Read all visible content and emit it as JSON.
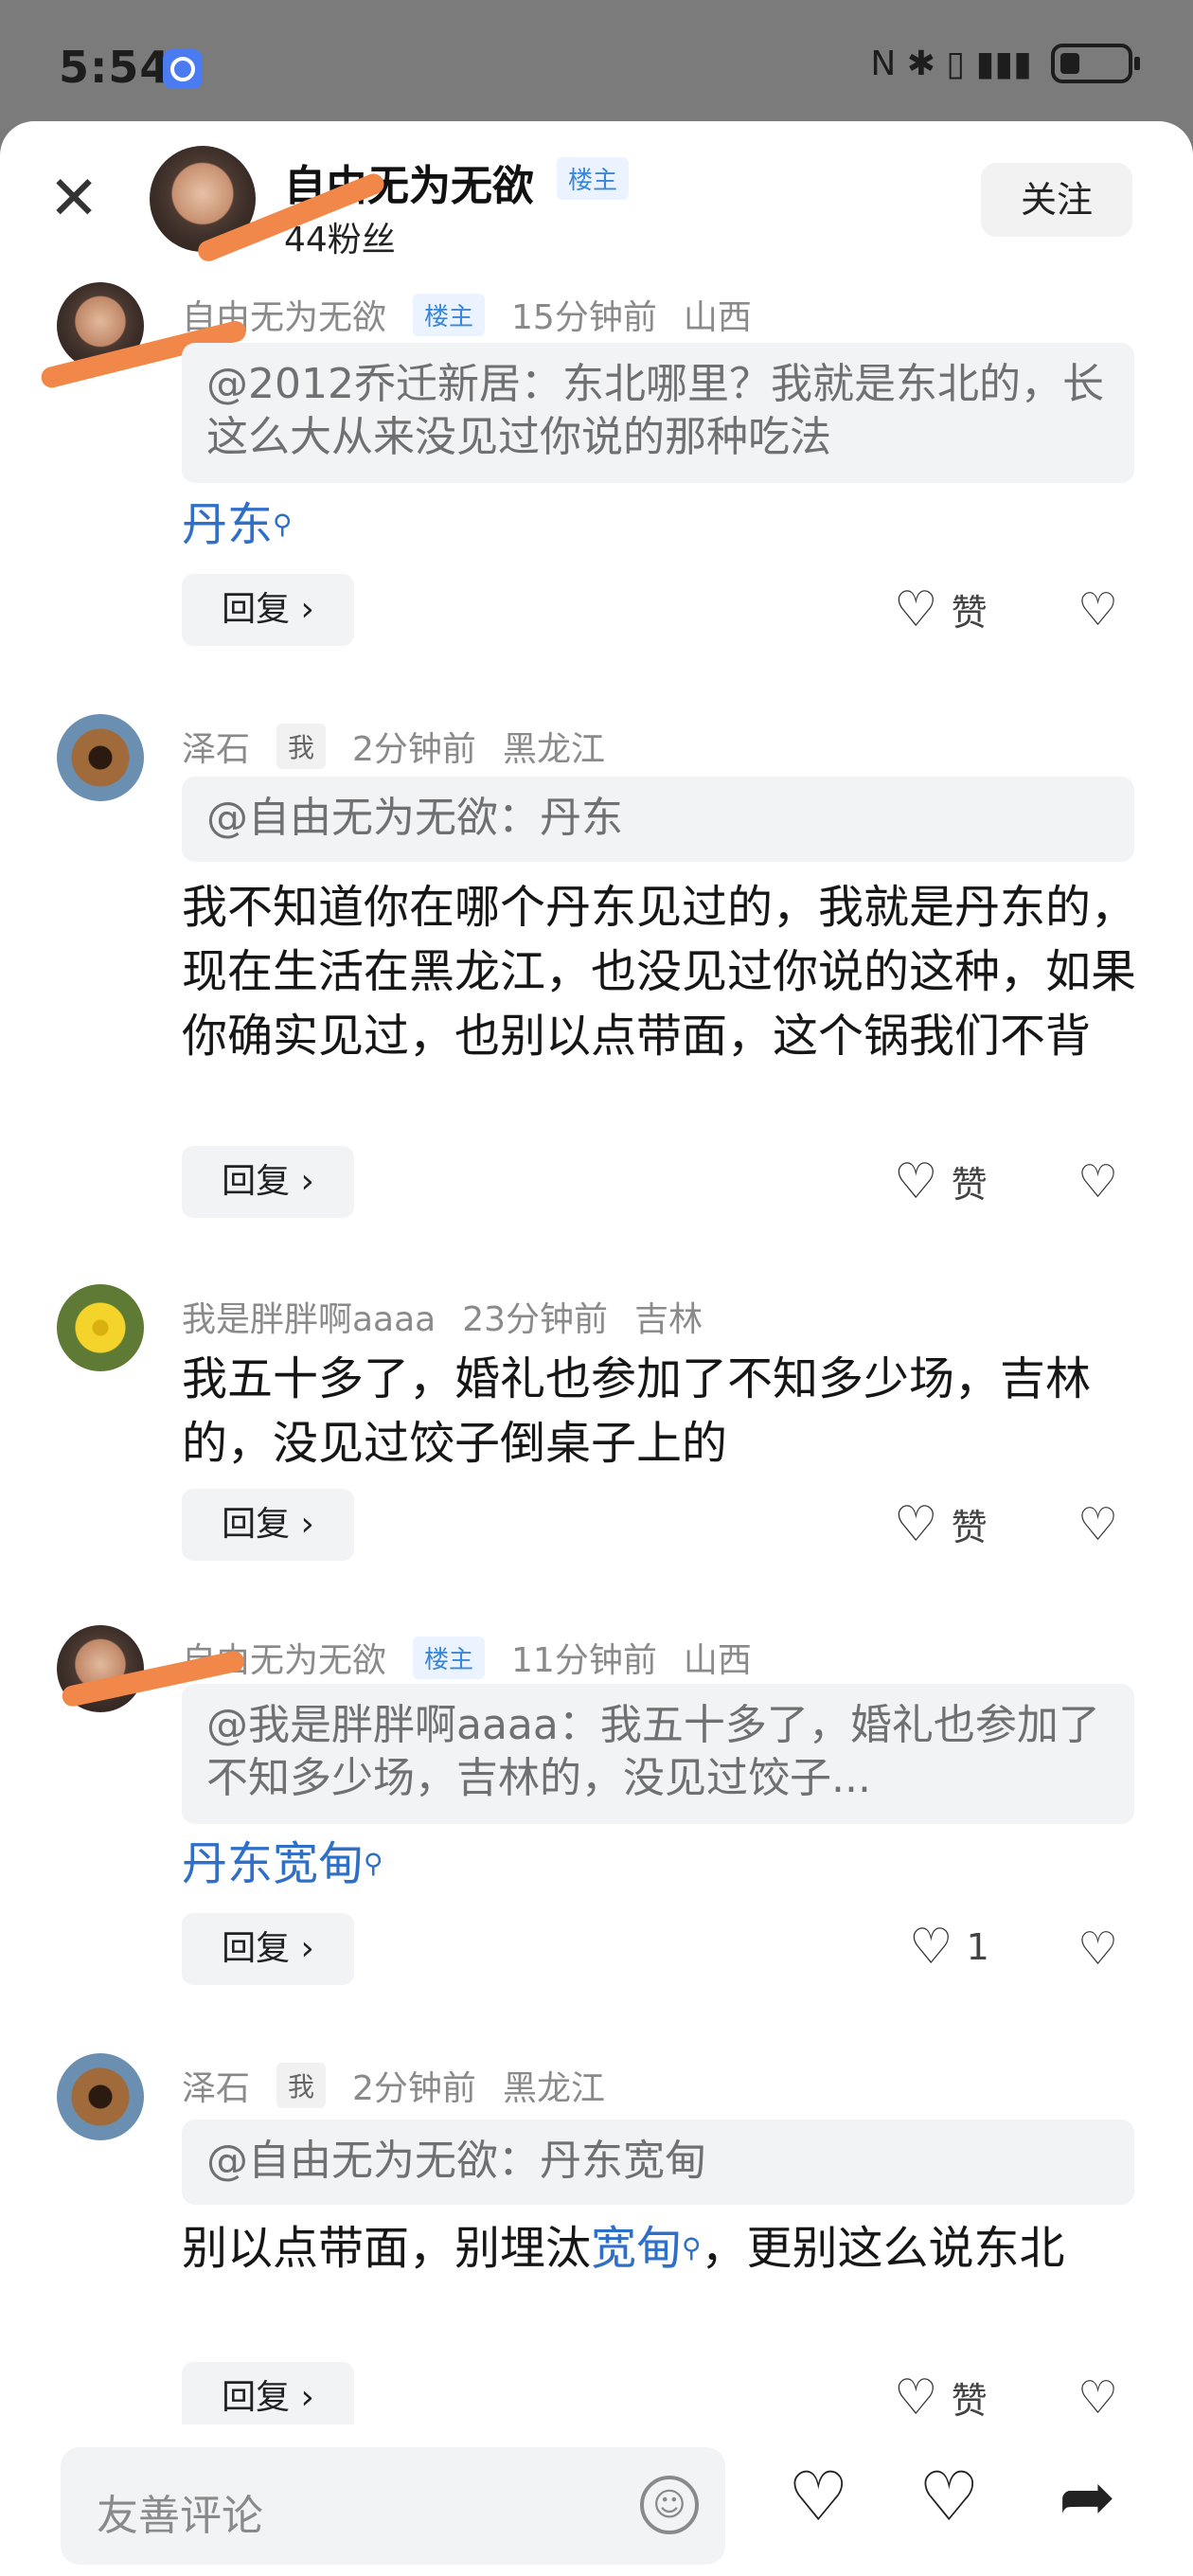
{
  "status": {
    "time": "5:54",
    "icons": "N ✱ ▯ ▮▮▮"
  },
  "header": {
    "name": "自由无为无欲",
    "badge": "楼主",
    "fans": "44粉丝",
    "follow": "关注",
    "close": "✕"
  },
  "comments": [
    {
      "user": "自由无为无欲",
      "badge": "楼主",
      "time": "15分钟前",
      "location": "山西",
      "quote": "@2012乔迁新居：东北哪里？我就是东北的，长这么大从来没见过你说的那种吃法",
      "text": "丹东",
      "reply": "回复 ›",
      "like": "赞"
    },
    {
      "user": "泽石",
      "tag": "我",
      "time": "2分钟前",
      "location": "黑龙江",
      "quote": "@自由无为无欲：丹东",
      "text": "我不知道你在哪个丹东见过的，我就是丹东的，现在生活在黑龙江，也没见过你说的这种，如果你确实见过，也别以点带面，这个锅我们不背",
      "reply": "回复 ›",
      "like": "赞"
    },
    {
      "user": "我是胖胖啊aaaa",
      "time": "23分钟前",
      "location": "吉林",
      "text": "我五十多了，婚礼也参加了不知多少场，吉林的，没见过饺子倒桌子上的",
      "reply": "回复 ›",
      "like": "赞"
    },
    {
      "user": "自由无为无欲",
      "badge": "楼主",
      "time": "11分钟前",
      "location": "山西",
      "quote": "@我是胖胖啊aaaa：我五十多了，婚礼也参加了不知多少场，吉林的，没见过饺子...",
      "text": "丹东宽甸",
      "reply": "回复 ›",
      "like": "1"
    },
    {
      "user": "泽石",
      "tag": "我",
      "time": "2分钟前",
      "location": "黑龙江",
      "quote": "@自由无为无欲：丹东宽甸",
      "text_a": "别以点带面，别埋汰",
      "text_link": "宽甸",
      "text_b": "，更别这么说东北",
      "reply": "回复 ›",
      "like": "赞"
    }
  ],
  "bottom": {
    "placeholder": "友善评论"
  },
  "colors": {
    "badge": "#3a86d8",
    "link": "#2f6fc8",
    "scribble": "#f2874a"
  }
}
